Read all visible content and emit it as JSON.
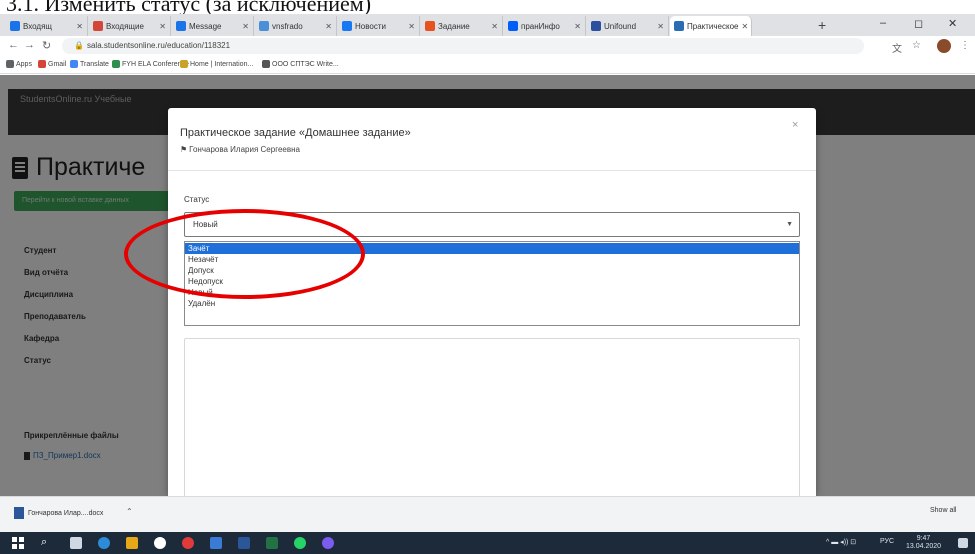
{
  "caption": "3.1. Изменить статус (за исключением)",
  "browser": {
    "tabs": [
      {
        "label": "Входящ",
        "color": "#1a73e8"
      },
      {
        "label": "Входящие",
        "color": "#d44638"
      },
      {
        "label": "Message",
        "color": "#1a73e8"
      },
      {
        "label": "vnsfrado",
        "color": "#4a90d9"
      },
      {
        "label": "Новости",
        "color": "#1877f2"
      },
      {
        "label": "Задание",
        "color": "#e7511e"
      },
      {
        "label": "пранИнфо",
        "color": "#005ff9"
      },
      {
        "label": "Unifound",
        "color": "#2d4fa0"
      },
      {
        "label": "Практическое",
        "color": "#2a6db5",
        "active": true
      }
    ],
    "new_tab": "+",
    "win_minimize": "–",
    "win_maximize": "◻",
    "win_close": "✕",
    "url": "sala.studentsonline.ru/education/118321",
    "bookmarks": [
      {
        "label": "Apps",
        "color": "#5f6368"
      },
      {
        "label": "Gmail",
        "color": "#d44638"
      },
      {
        "label": "Translate",
        "color": "#4285f4"
      },
      {
        "label": "FYH ELA Conference",
        "color": "#2f8f4e"
      },
      {
        "label": "Home | Internation...",
        "color": "#c9a227"
      },
      {
        "label": "ООО СПТЭС Write...",
        "color": "#555555"
      }
    ]
  },
  "page": {
    "brand": "StudentsOnline.ru  Учебные",
    "title": "Практиче",
    "change_button": "Перейти к новой вставке данных",
    "fields": [
      "Студент",
      "Вид отчёта",
      "Дисциплина",
      "Преподаватель",
      "Кафедра",
      "Статус"
    ],
    "files_label": "Прикреплённые файлы",
    "file_name": "ПЗ_Пример1.docx"
  },
  "modal": {
    "title": "Практическое задание «Домашнее задание»",
    "student": "Гончарова Илария Сергеевна",
    "close": "×",
    "status_label": "Статус",
    "status_value": "Новый",
    "options": [
      {
        "label": "Зачёт",
        "selected": true
      },
      {
        "label": "Незачёт"
      },
      {
        "label": "Допуск"
      },
      {
        "label": "Недопуск"
      },
      {
        "label": "Новый"
      },
      {
        "label": "Удалён"
      }
    ],
    "annotation_color": "#e60000"
  },
  "downloads": {
    "item": "Гончарова Илар....docx",
    "show_all": "Show all"
  },
  "taskbar": {
    "tray_text": "РУС",
    "time": "9:47",
    "date": "13.04.2020"
  }
}
